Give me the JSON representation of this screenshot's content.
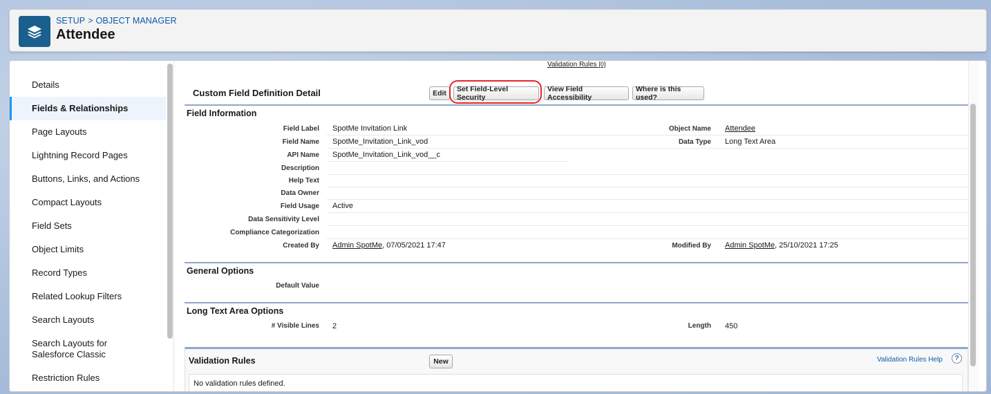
{
  "header": {
    "breadcrumb": {
      "setup": "SETUP",
      "separator": ">",
      "object_manager": "OBJECT MANAGER"
    },
    "title": "Attendee",
    "logo_icon": "layers-icon"
  },
  "sidebar": {
    "items": [
      {
        "label": "Details",
        "active": false
      },
      {
        "label": "Fields & Relationships",
        "active": true
      },
      {
        "label": "Page Layouts",
        "active": false
      },
      {
        "label": "Lightning Record Pages",
        "active": false
      },
      {
        "label": "Buttons, Links, and Actions",
        "active": false
      },
      {
        "label": "Compact Layouts",
        "active": false
      },
      {
        "label": "Field Sets",
        "active": false
      },
      {
        "label": "Object Limits",
        "active": false
      },
      {
        "label": "Record Types",
        "active": false
      },
      {
        "label": "Related Lookup Filters",
        "active": false
      },
      {
        "label": "Search Layouts",
        "active": false
      },
      {
        "label": "Search Layouts for Salesforce Classic",
        "active": false
      },
      {
        "label": "Restriction Rules",
        "active": false
      }
    ]
  },
  "content": {
    "top_link": {
      "label": "Validation Rules",
      "count": "[0]"
    },
    "detail_title": "Custom Field Definition Detail",
    "buttons": {
      "edit": "Edit",
      "set_fls": "Set Field-Level Security",
      "view_access": "View Field Accessibility",
      "where_used": "Where is this used?"
    },
    "field_information": {
      "heading": "Field Information",
      "field_label": {
        "label": "Field Label",
        "value": "SpotMe Invitation Link"
      },
      "object_name": {
        "label": "Object Name",
        "value": "Attendee"
      },
      "field_name": {
        "label": "Field Name",
        "value": "SpotMe_Invitation_Link_vod"
      },
      "data_type": {
        "label": "Data Type",
        "value": "Long Text Area"
      },
      "api_name": {
        "label": "API Name",
        "value": "SpotMe_Invitation_Link_vod__c"
      },
      "description": {
        "label": "Description",
        "value": ""
      },
      "help_text": {
        "label": "Help Text",
        "value": ""
      },
      "data_owner": {
        "label": "Data Owner",
        "value": ""
      },
      "field_usage": {
        "label": "Field Usage",
        "value": "Active"
      },
      "data_sensitivity": {
        "label": "Data Sensitivity Level",
        "value": ""
      },
      "compliance": {
        "label": "Compliance Categorization",
        "value": ""
      },
      "created_by": {
        "label": "Created By",
        "user": "Admin SpotMe",
        "date": ", 07/05/2021 17:47"
      },
      "modified_by": {
        "label": "Modified By",
        "user": "Admin SpotMe",
        "date": ", 25/10/2021 17:25"
      }
    },
    "general_options": {
      "heading": "General Options",
      "default_value": {
        "label": "Default Value",
        "value": ""
      }
    },
    "long_text_options": {
      "heading": "Long Text Area Options",
      "visible_lines": {
        "label": "# Visible Lines",
        "value": "2"
      },
      "length": {
        "label": "Length",
        "value": "450"
      }
    },
    "validation_rules": {
      "heading": "Validation Rules",
      "new_button": "New",
      "help_link": "Validation Rules Help",
      "help_icon": "?",
      "empty_message": "No validation rules defined."
    }
  }
}
